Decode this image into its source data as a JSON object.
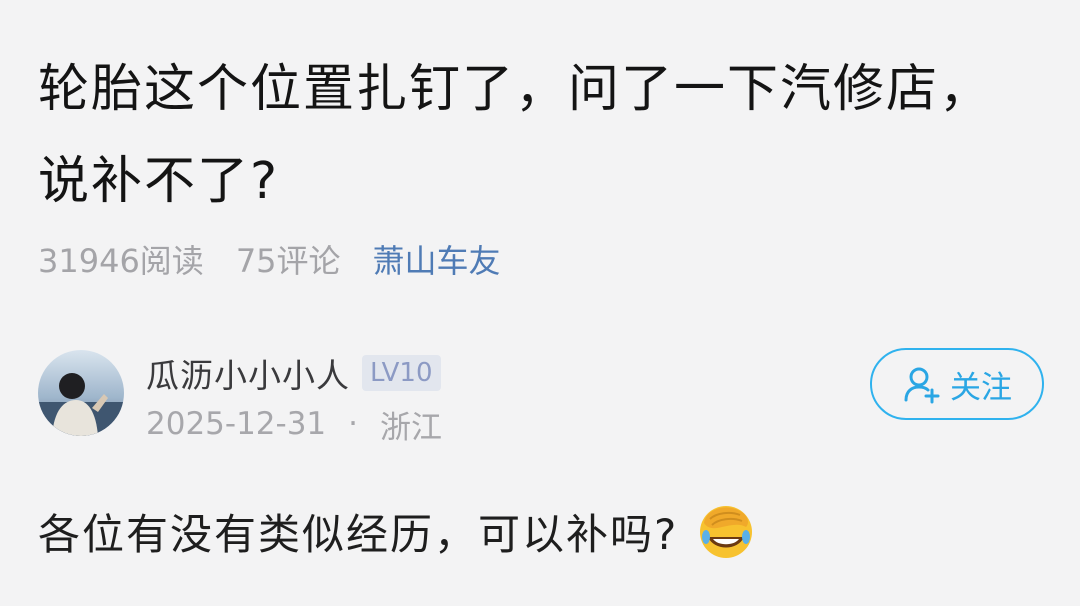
{
  "post": {
    "title": "轮胎这个位置扎钉了，问了一下汽修店，说补不了?",
    "reads": "31946阅读",
    "comments": "75评论",
    "community": "萧山车友"
  },
  "author": {
    "name": "瓜沥小小小人",
    "level": "LV10",
    "date": "2025-12-31",
    "separator": "·",
    "location": "浙江",
    "follow_label": "关注"
  },
  "content": {
    "text": "各位有没有类似经历，可以补吗?",
    "emoji": "face-palm-laughing-emoji"
  },
  "colors": {
    "accent": "#2fb2ee",
    "community_link": "#4f7bb5",
    "muted": "#a4a4a8",
    "background": "#f3f3f4"
  }
}
